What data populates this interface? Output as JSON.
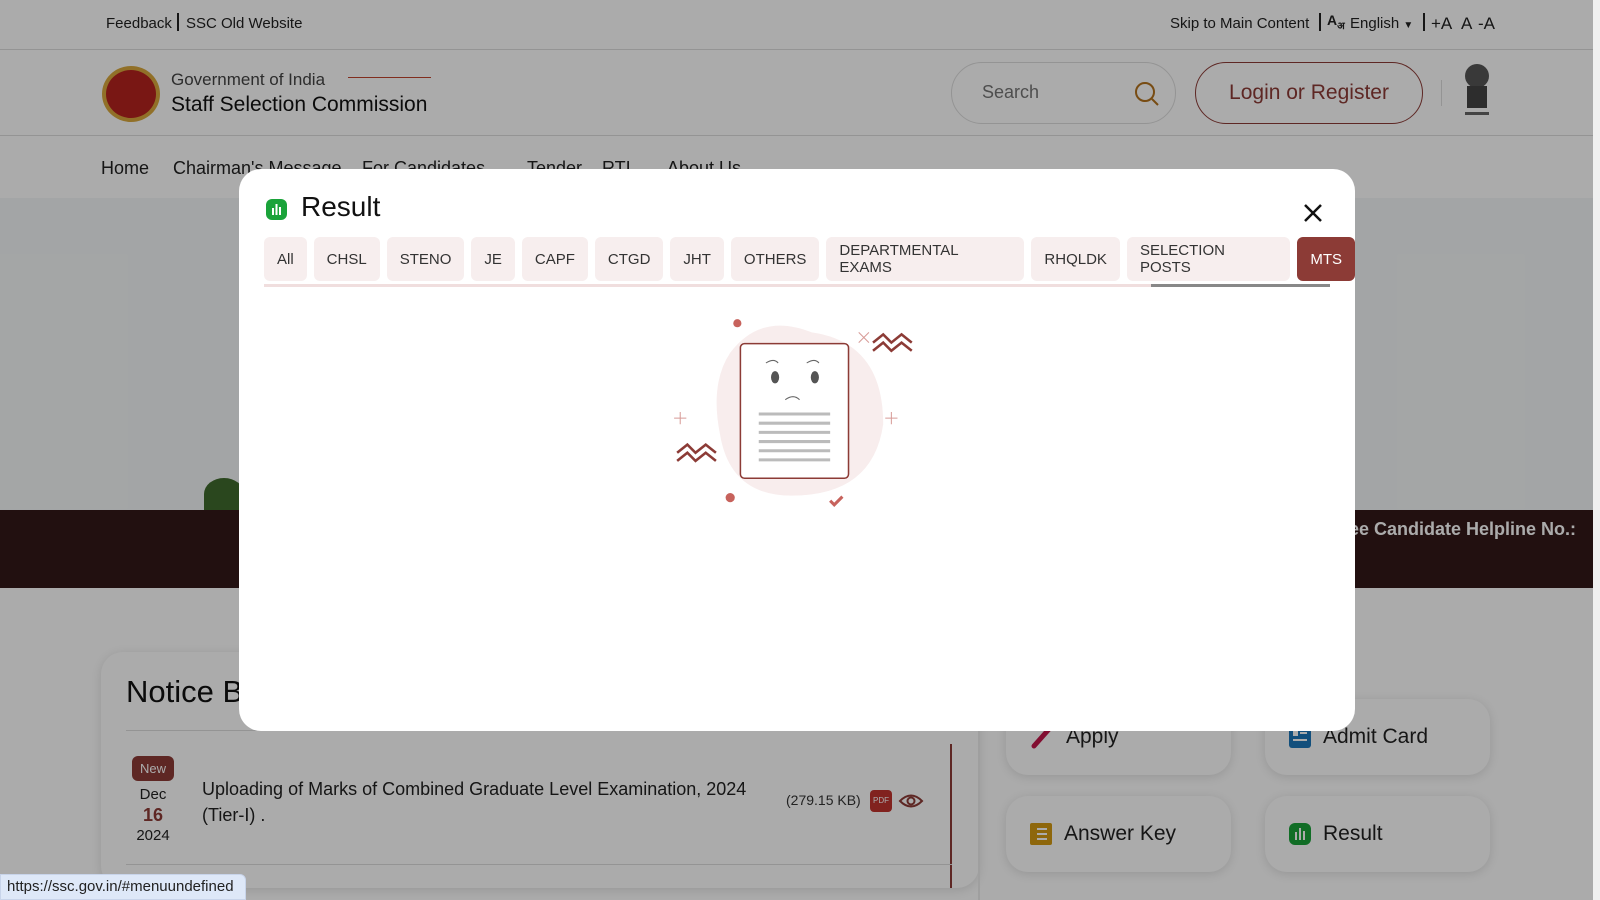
{
  "topbar": {
    "feedback": "Feedback",
    "old_website": "SSC Old Website",
    "skip": "Skip to Main Content",
    "language": "English",
    "font_increase": "+A",
    "font_normal": "A",
    "font_decrease": "-A"
  },
  "header": {
    "gov": "Government of India",
    "org": "Staff Selection Commission",
    "search_placeholder": "Search",
    "login": "Login or Register"
  },
  "nav": {
    "items": [
      "Home",
      "Chairman's Message",
      "For Candidates",
      "Tender",
      "RTI",
      "About Us"
    ]
  },
  "ticker": {
    "text": "ee Candidate Helpline No.:"
  },
  "notice": {
    "title": "Notice Board",
    "badge": "New",
    "month": "Dec",
    "day": "16",
    "year": "2024",
    "text": "Uploading of Marks of Combined Graduate Level Examination, 2024 (Tier-I) .",
    "size": "(279.15 KB)",
    "pdf": "PDF"
  },
  "quick": {
    "apply": "Apply",
    "admit": "Admit Card",
    "answer": "Answer Key",
    "result": "Result"
  },
  "modal": {
    "title": "Result",
    "tabs": [
      "All",
      "CHSL",
      "STENO",
      "JE",
      "CAPF",
      "CTGD",
      "JHT",
      "OTHERS",
      "DEPARTMENTAL EXAMS",
      "RHQLDK",
      "SELECTION POSTS",
      "MTS"
    ],
    "active_tab": "MTS"
  },
  "status_url": "https://ssc.gov.in/#menuundefined",
  "colors": {
    "brand": "#8c3b36",
    "result_icon": "#1aa33a",
    "ticker": "#341818"
  }
}
